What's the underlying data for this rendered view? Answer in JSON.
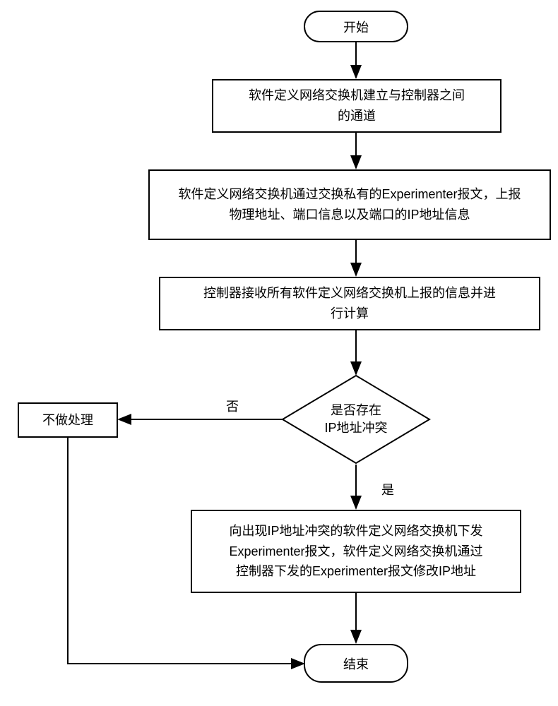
{
  "chart_data": {
    "type": "flowchart",
    "nodes": [
      {
        "id": "start",
        "type": "terminal",
        "label": "开始"
      },
      {
        "id": "p1",
        "type": "process",
        "label": "软件定义网络交换机建立与控制器之间的通道"
      },
      {
        "id": "p2",
        "type": "process",
        "label": "软件定义网络交换机通过交换私有的Experimenter报文，上报物理地址、端口信息以及端口的IP地址信息"
      },
      {
        "id": "p3",
        "type": "process",
        "label": "控制器接收所有软件定义网络交换机上报的信息并进行计算"
      },
      {
        "id": "d1",
        "type": "decision",
        "label": "是否存在IP地址冲突"
      },
      {
        "id": "p4",
        "type": "process",
        "label": "不做处理"
      },
      {
        "id": "p5",
        "type": "process",
        "label": "向出现IP地址冲突的软件定义网络交换机下发Experimenter报文，软件定义网络交换机通过控制器下发的Experimenter报文修改IP地址"
      },
      {
        "id": "end",
        "type": "terminal",
        "label": "结束"
      }
    ],
    "edges": [
      {
        "from": "start",
        "to": "p1"
      },
      {
        "from": "p1",
        "to": "p2"
      },
      {
        "from": "p2",
        "to": "p3"
      },
      {
        "from": "p3",
        "to": "d1"
      },
      {
        "from": "d1",
        "to": "p4",
        "label": "否"
      },
      {
        "from": "d1",
        "to": "p5",
        "label": "是"
      },
      {
        "from": "p4",
        "to": "end"
      },
      {
        "from": "p5",
        "to": "end"
      }
    ]
  },
  "nodes": {
    "start": "开始",
    "p1_line1": "软件定义网络交换机建立与控制器之间",
    "p1_line2": "的通道",
    "p2_line1": "软件定义网络交换机通过交换私有的Experimenter报文，上报",
    "p2_line2": "物理地址、端口信息以及端口的IP地址信息",
    "p3_line1": "控制器接收所有软件定义网络交换机上报的信息并进",
    "p3_line2": "行计算",
    "d1_line1": "是否存在",
    "d1_line2": "IP地址冲突",
    "p4": "不做处理",
    "p5_line1": "向出现IP地址冲突的软件定义网络交换机下发",
    "p5_line2": "Experimenter报文，软件定义网络交换机通过",
    "p5_line3": "控制器下发的Experimenter报文修改IP地址",
    "end": "结束"
  },
  "labels": {
    "no": "否",
    "yes": "是"
  }
}
